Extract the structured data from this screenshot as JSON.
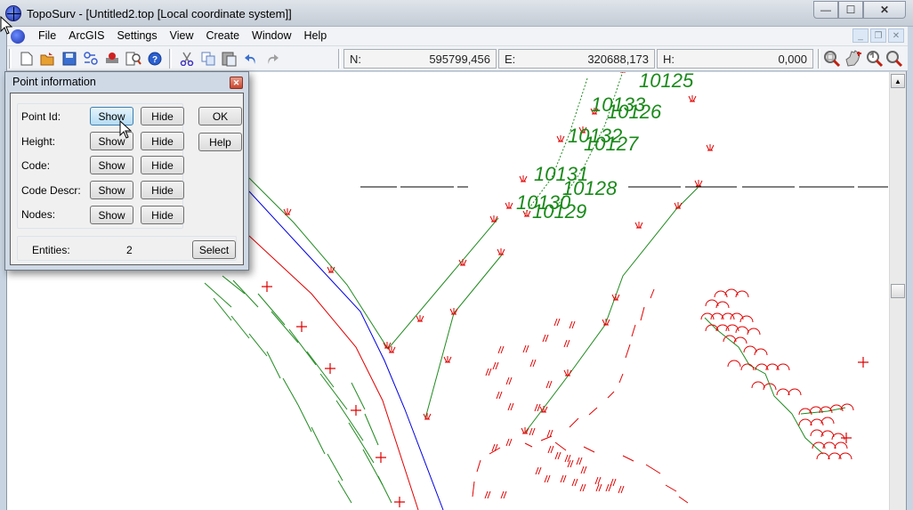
{
  "window": {
    "title": "TopoSurv - [Untitled2.top [Local coordinate system]]",
    "controls": {
      "minimize": "—",
      "maximize": "☐",
      "close": "✕"
    }
  },
  "menubar": {
    "items": [
      "File",
      "ArcGIS",
      "Settings",
      "View",
      "Create",
      "Window",
      "Help"
    ],
    "mdi_controls": {
      "minimize": "_",
      "restore": "❐",
      "close": "✕"
    }
  },
  "toolbar": {
    "buttons": [
      "new-icon",
      "open-icon",
      "save-icon",
      "network-icon",
      "print-icon",
      "preview-icon",
      "help-icon",
      "cut-icon",
      "copy-icon",
      "paste-icon",
      "undo-icon",
      "redo-icon"
    ],
    "coords": {
      "n_label": "N:",
      "n_value": "595799,456",
      "e_label": "E:",
      "e_value": "320688,173",
      "h_label": "H:",
      "h_value": "0,000"
    },
    "zoom_buttons": [
      "zoom-extents-icon",
      "pan-icon",
      "zoom-previous-icon",
      "zoom-window-icon"
    ]
  },
  "dialog": {
    "title": "Point information",
    "close": "✕",
    "rows": [
      {
        "label": "Point Id:",
        "show": "Show",
        "hide": "Hide"
      },
      {
        "label": "Height:",
        "show": "Show",
        "hide": "Hide"
      },
      {
        "label": "Code:",
        "show": "Show",
        "hide": "Hide"
      },
      {
        "label": "Code Descr:",
        "show": "Show",
        "hide": "Hide"
      },
      {
        "label": "Nodes:",
        "show": "Show",
        "hide": "Hide"
      }
    ],
    "ok": "OK",
    "help": "Help",
    "entities_label": "Entities:",
    "entities_value": "2",
    "select": "Select"
  },
  "drawing": {
    "point_labels": [
      "10125",
      "10133",
      "10126",
      "10132",
      "10127",
      "10131",
      "10128",
      "10130",
      "10129"
    ],
    "colors": {
      "label": "#1a8a1a",
      "green_line": "#1f8a1f",
      "red_line": "#e00000",
      "blue_line": "#0000e0",
      "black_line": "#000000"
    }
  },
  "scrollbar": {
    "up_arrow": "▲"
  }
}
